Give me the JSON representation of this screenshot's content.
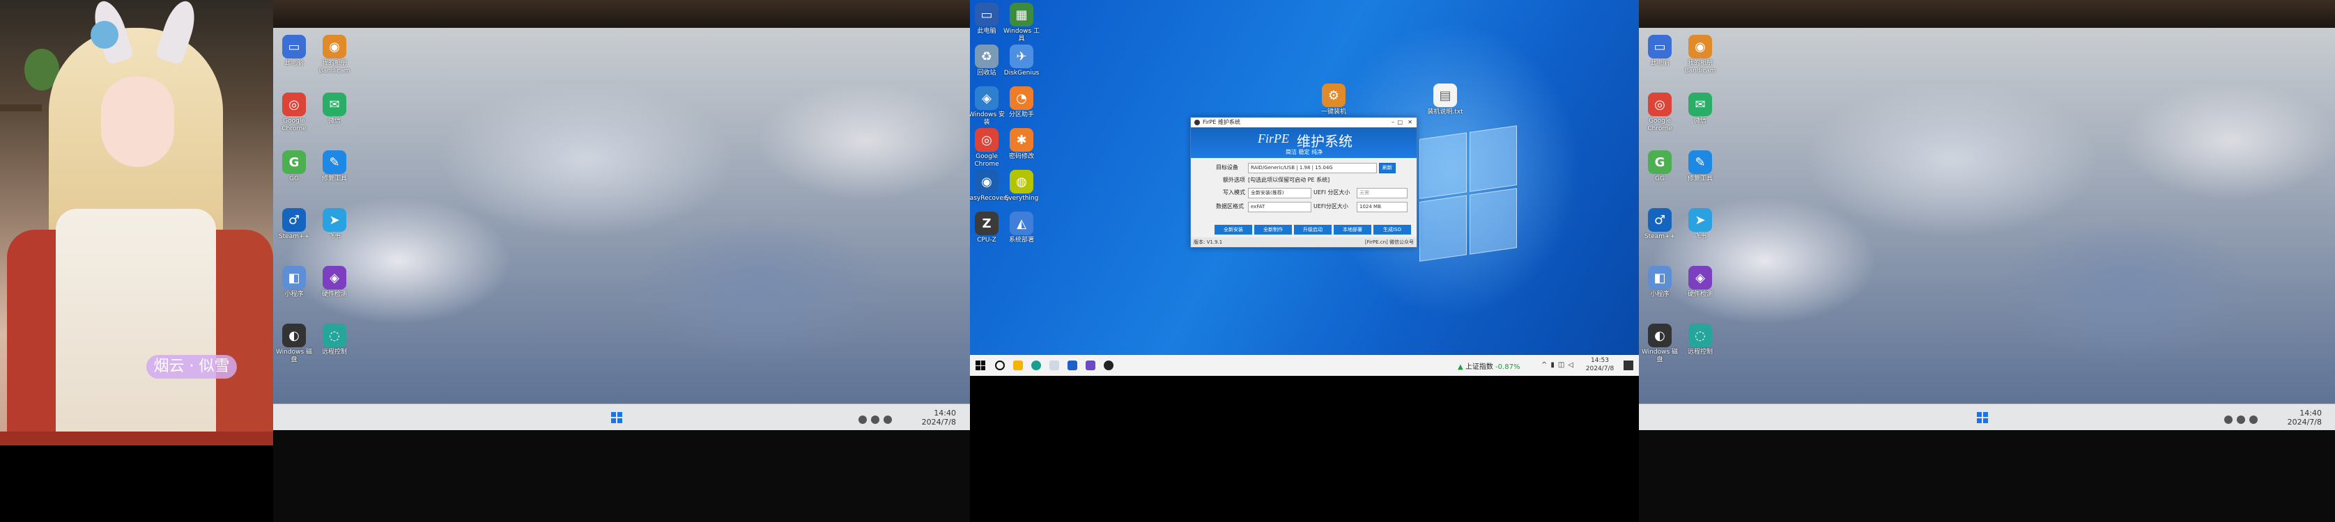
{
  "photo": {
    "caption": "烟云 · 似雪"
  },
  "monitor_left": {
    "desktop_icons": [
      {
        "label": "此电脑",
        "icon": "computer-icon",
        "color": "#3a6fd8",
        "glyph": "▭"
      },
      {
        "label": "我的相册 Bandicam",
        "icon": "camera-icon",
        "color": "#e08a2a",
        "glyph": "◉"
      },
      {
        "label": "Google Chrome",
        "icon": "chrome-icon",
        "color": "#db4437",
        "glyph": "◎"
      },
      {
        "label": "微信",
        "icon": "wechat-icon",
        "color": "#2aae67",
        "glyph": "✉"
      },
      {
        "label": "GG",
        "icon": "g-app-icon",
        "color": "#4caf50",
        "glyph": "G"
      },
      {
        "label": "修复工具",
        "icon": "tool-icon",
        "color": "#1e88e5",
        "glyph": "✎"
      },
      {
        "label": "Steam++",
        "icon": "steam-icon",
        "color": "#1565c0",
        "glyph": "♂"
      },
      {
        "label": "飞书",
        "icon": "telegram-icon",
        "color": "#2aa1e0",
        "glyph": "➤"
      },
      {
        "label": "小程序",
        "icon": "app-icon",
        "color": "#5c8fd6",
        "glyph": "◧"
      },
      {
        "label": "硬件检测",
        "icon": "monitor-icon",
        "color": "#7b3fbf",
        "glyph": "◈"
      },
      {
        "label": "Windows 磁盘",
        "icon": "disk-icon",
        "color": "#333333",
        "glyph": "◐"
      },
      {
        "label": "远程控制",
        "icon": "remote-icon",
        "color": "#26a69a",
        "glyph": "◌"
      }
    ],
    "tray": {
      "time": "14:40",
      "date": "2024/7/8"
    }
  },
  "win10": {
    "desktop_icons": [
      {
        "label": "此电脑",
        "icon": "computer-icon",
        "color": "#2a5db0",
        "glyph": "▭"
      },
      {
        "label": "Windows 工具",
        "icon": "tools-icon",
        "color": "#3d8b3d",
        "glyph": "▦"
      },
      {
        "label": "回收站",
        "icon": "recycle-bin-icon",
        "color": "#7a9ab8",
        "glyph": "♻"
      },
      {
        "label": "DiskGenius",
        "icon": "bird-icon",
        "color": "#4d8fe0",
        "glyph": "✈"
      },
      {
        "label": "Windows 安装",
        "icon": "windows-setup-icon",
        "color": "#2f7fd0",
        "glyph": "◈"
      },
      {
        "label": "分区助手",
        "icon": "partition-icon",
        "color": "#ef7d28",
        "glyph": "◔"
      },
      {
        "label": "Google Chrome",
        "icon": "chrome-icon",
        "color": "#db4437",
        "glyph": "◎"
      },
      {
        "label": "密码修改",
        "icon": "key-icon",
        "color": "#ef7d28",
        "glyph": "✱"
      },
      {
        "label": "EasyRecovery",
        "icon": "recovery-icon",
        "color": "#1a5fb4",
        "glyph": "◉"
      },
      {
        "label": "Everything",
        "icon": "search-app-icon",
        "color": "#b5c400",
        "glyph": "◍"
      },
      {
        "label": "CPU-Z",
        "icon": "cpu-icon",
        "color": "#3b3b3b",
        "glyph": "Z"
      },
      {
        "label": "系统部署",
        "icon": "deploy-icon",
        "color": "#3f7fd9",
        "glyph": "◭"
      }
    ],
    "desktop_file_icons": [
      {
        "label": "一键装机",
        "icon": "install-icon"
      },
      {
        "label": "装机说明.txt",
        "icon": "text-file-icon"
      }
    ],
    "firpe": {
      "title": "FirPE 维护系统",
      "banner_logo": "FirPE",
      "banner_title": "维护系统",
      "banner_subtitle": "简洁 稳定 纯净",
      "target_label": "目标设备",
      "target_value": "RAID/Generic/USB | 1.98 | 15.04G",
      "refresh": "刷新",
      "options_label": "额外选项",
      "options_value": "[勾选此项以保留可启动 PE 系统]",
      "mode_label": "写入模式",
      "mode_value": "全新安装(推荐)",
      "ue_label": "UEFI 分区大小",
      "ue_value": "无需",
      "fs_label": "数据区格式",
      "fs_value": "exFAT",
      "size_label": "UEFI分区大小",
      "size_value": "1024 MB",
      "buttons": [
        "全新安装",
        "全新制作",
        "升级启动",
        "本地部署",
        "生成ISO"
      ],
      "status_left": "版本: V1.9.1",
      "status_right": "[FirPE.cn] 微信公众号"
    },
    "taskbar": {
      "weather": "上证指数",
      "weather_delta": "-0.87%",
      "time": "14:53",
      "date": "2024/7/8"
    }
  },
  "monitor_right": {
    "tray": {
      "time": "14:40",
      "date": "2024/7/8"
    }
  }
}
